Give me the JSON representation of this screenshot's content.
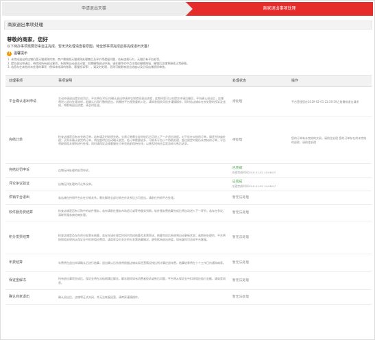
{
  "steps": [
    "申请退出天猫",
    "商家退出事项处理"
  ],
  "section_title": "商家退出事项处理",
  "greeting": "尊敬的商家，您好",
  "intro": "以下待办事项需要您来自主完成，暂无法处理请查看原因，待全部事项完成后将完成退出天猫！",
  "tips": {
    "title": "温馨提示",
    "lines": [
      "1. 未完成退出的店铺仍受天猫规则约束，商户需按照天猫规则处理售后及评价等遗留问题，若有违规行为，天猫仍有平台处罚。",
      "2. 提交退出申请后，待完成所有退出事项，系统将自动退出天猫；如需撤销退出申请，请在操作栏中点击相应撤销按钮，撤销后店铺将继续正常经营。",
      "3. 若您存在其他尚未处理的事项（例如未结清的账款、客服投诉等），请及时处理，否则可能影响退出进度以及后续店铺资质审核。"
    ]
  },
  "table": {
    "headers": [
      "处理事项",
      "事项说明",
      "处理状态",
      "操作"
    ],
    "rows": [
      {
        "name": "平台确认退出申请",
        "desc": "主动申请退出提交成功后，平台将在30日内确认退出申请并告知商家退出流程，此期间您可以在提交申请后撤回，平台确认退出后，店铺将进入退出处理流程，若确认后再行撤销退出，则需按平台规则重新入驻，请知悉相关风险并谨慎操作，同时若店铺存在未处理的投诉及违规，将影响退出进度，请及时处理。",
        "status": "待处理",
        "status_color": "red",
        "op": "平台受理您在2019-02-01 23:59:59之前撤销退出请求"
      },
      {
        "name": "完结订单",
        "desc": "检查店铺是否有未完结订单，若有请及时处理完结，交易订单需全部完结后方可进入下一步退出流程。对于存在纠纷的订单，请优先协商处理；买家未确认收货的订单，将在超时后自动确认收货，若订单数量较多，可联系平台小二协助处理，超过规定时限仍未完结的订单，平台将按照相关规则进行处理，同时请保证店铺客服在订单完结前保持在线，以便及时响应买家咨询与售后诉求。",
        "status": "待处理",
        "status_color": "red",
        "op": "您的订单有未完结的交易，请前往处理 您的订单存在尚未完结的退款，请前往处理"
      },
      {
        "name": "完结处罚申诉",
        "desc": "店铺无待处理的处罚申诉。",
        "status": "已完成",
        "status_sub": "处理完成时间2019-01-02 10:08:07",
        "status_color": "green",
        "op": ""
      },
      {
        "name": "评论争议验证",
        "desc": "店铺无待处理的评论争议单。",
        "status": "已完成",
        "status_sub": "处理完成时间2019-01-02 10:08:07",
        "status_color": "green",
        "op": ""
      },
      {
        "name": "供销平台退出",
        "desc": "若店铺在供销平台存在分销关系，需先解除全部分销合作关系后方可退出，请前往供销平台处理。",
        "status": "暂无法处理",
        "status_color": "dark",
        "op": ""
      },
      {
        "name": "软件服务费结算",
        "desc": "检查店铺是否有订购中的软件服务，若有请前往服务市场退订或等待服务到期，软件服务费结算完成后将自动进入下一环节；若存在争议，请联系服务商协商处理。",
        "status": "暂无法处理",
        "status_color": "dark",
        "op": ""
      },
      {
        "name": "积分发票结算",
        "desc": "检查店铺是否存在积分发票未结算，若存在请在规定时间内完成结算及发票寄送，结算完成后系统将自动更新状态；逾期未处理的，平台将按照相关规则从保证金中扣除相应费用，请商家及时关注积分发票结算情况，避免影响退出进度，如有疑问可咨询平台客服。",
        "status": "暂无法处理",
        "status_color": "dark",
        "op": ""
      },
      {
        "name": "年费结算",
        "desc": "年费将在退出申请确认后进行结算，退出确认后系统将根据店铺实际经营情况按比例计算应退年费，结算结果将在十个工作日内通知商家。",
        "status": "暂无法处理",
        "status_color": "dark",
        "op": ""
      },
      {
        "name": "保证金解冻",
        "desc": "所有退出事项完成后，保证金将在冻结期满后解冻，解冻期间如有消费者投诉或售后问题，平台将从保证金中扣除相应赔付金额，请商家知悉。",
        "status": "暂无法处理",
        "status_color": "dark",
        "op": ""
      },
      {
        "name": "确认商家退出",
        "desc": "确认退出后，店铺将正式关闭，并无法恢复经营，请商家谨慎操作。",
        "status": "暂无法处理",
        "status_color": "dark",
        "op": ""
      }
    ]
  }
}
